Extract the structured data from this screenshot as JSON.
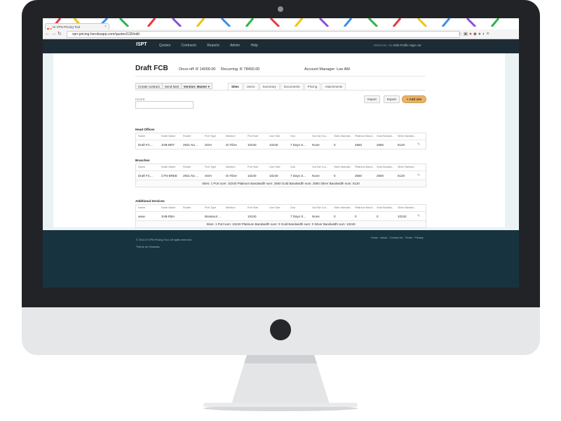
{
  "browser": {
    "tab_title": "IS VPN Pricing Tool",
    "url": "vpn-pricing.herokuapp.com/quotes/130/edit"
  },
  "nav": {
    "brand": "ISPT",
    "links": [
      "Quotes",
      "Contracts",
      "Reports",
      "Admin",
      "Help"
    ],
    "welcome": "Welcome, Sa",
    "edit_profile": "Edit Profile",
    "sign_out": "Sign out"
  },
  "header": {
    "title": "Draft FCB",
    "once_off": "Once-off: R 14000.00",
    "recurring": "Recurring: R 78450.00",
    "account_manager": "Account Manager: Lee AM"
  },
  "toolbar": {
    "create_contract": "Create contract",
    "send_mail": "Send Mail",
    "version": "Version: Master"
  },
  "tabs": [
    "Sites",
    "Users",
    "Summary",
    "Documents",
    "Pricing",
    "Attachments"
  ],
  "filter": {
    "label": "FILTER",
    "placeholder": ""
  },
  "actions": {
    "import": "Import",
    "export": "Export",
    "add_site": "+ Add site"
  },
  "columns": [
    "Name",
    "Node Name",
    "Router",
    "Port Type",
    "Medium",
    "Port Size",
    "Line Size",
    "Gos",
    "Vox Bw Col...",
    "Video Bandwi...",
    "Platinum Band...",
    "Gold Bandwi...",
    "Silver Bandwi..."
  ],
  "sections": [
    {
      "title": "Head Offices",
      "rows": [
        [
          "Draft FC...",
          "JHB-BRY",
          "2921 No ...",
          "SOH",
          "IS Fibre",
          "10240",
          "10240",
          "7 Days S...",
          "None",
          "0",
          "2560",
          "2560",
          "5120"
        ]
      ],
      "summary": ""
    },
    {
      "title": "Branches",
      "rows": [
        [
          "Draft FC...",
          "CTN-BREE",
          "2921 No ...",
          "SOH",
          "IS Fibre",
          "10240",
          "10240",
          "7 Days S...",
          "None",
          "0",
          "2560",
          "2560",
          "5120"
        ]
      ],
      "summary": "Sites: 1   Port sum: 10240   Platinum Bandwidth sum: 2560   Gold Bandwidth sum: 2560   Silver Bandwidth sum: 5120"
    },
    {
      "title": "Additional Services",
      "rows": [
        [
          "www",
          "JHB-RBA",
          "",
          "Breakout ...",
          "",
          "10240",
          "",
          "7 Days S...",
          "None",
          "0",
          "0",
          "0",
          "10240"
        ]
      ],
      "summary": "Sites: 1   Port sum: 10240   Platinum Bandwidth sum: 0   Gold Bandwidth sum: 0   Silver Bandwidth sum: 10240"
    }
  ],
  "footer": {
    "copyright": "© 2014 IS VPN Pricing Tool. All rights reserved.",
    "theme": "Theme by Onassiss",
    "links": "Home · About · Contact Us · Terms · Privacy"
  }
}
